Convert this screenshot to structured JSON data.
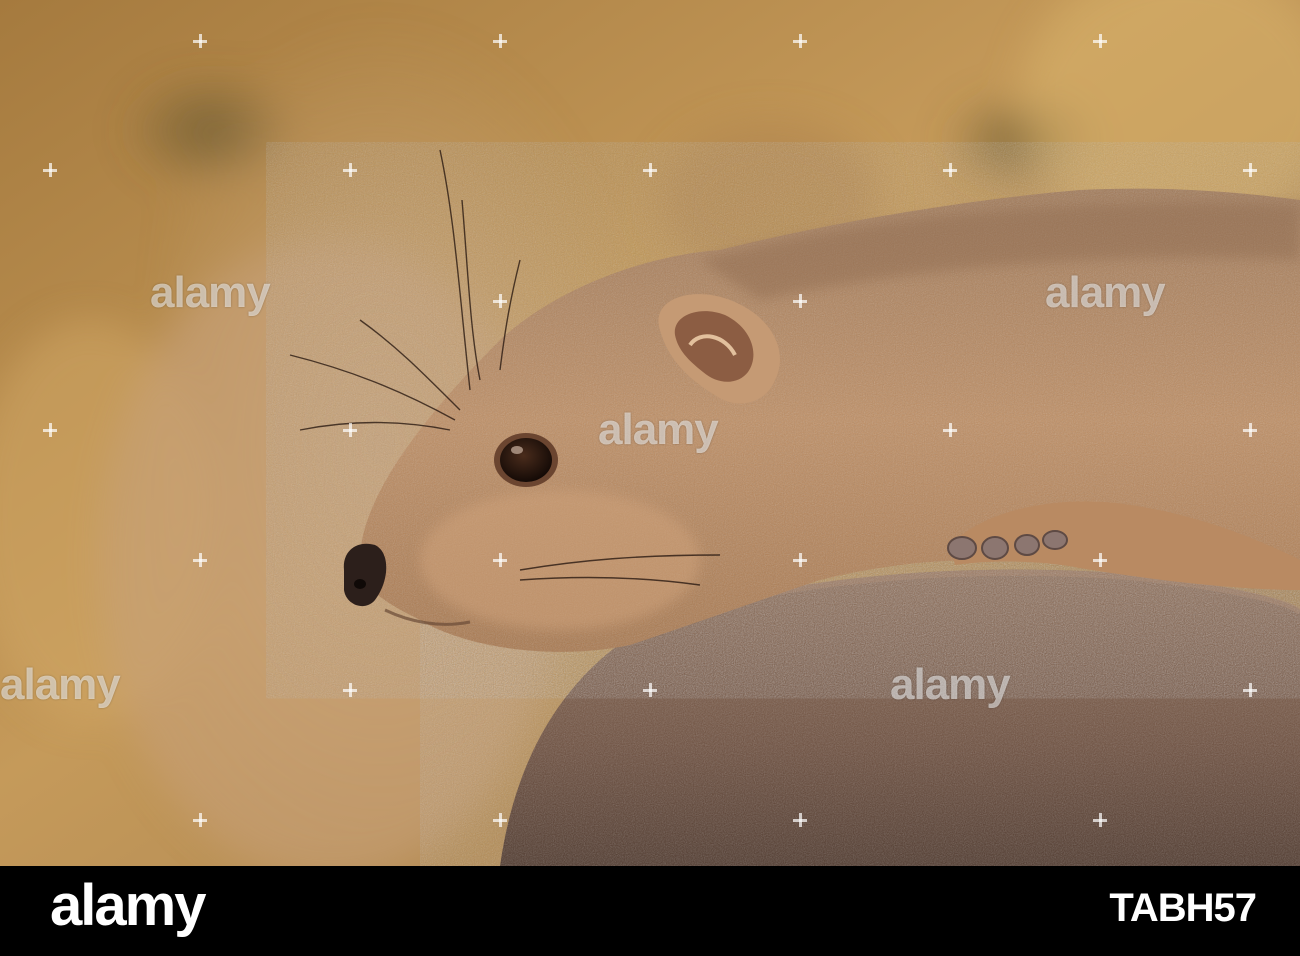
{
  "photo": {
    "subject": "rock-hyrax",
    "palette": {
      "background": "#b98c4e",
      "fur": "#b8875c",
      "rock": "#7d5a45"
    }
  },
  "watermark": {
    "text": "alamy"
  },
  "footer": {
    "logo": "alamy",
    "image_id": "TABH57"
  }
}
